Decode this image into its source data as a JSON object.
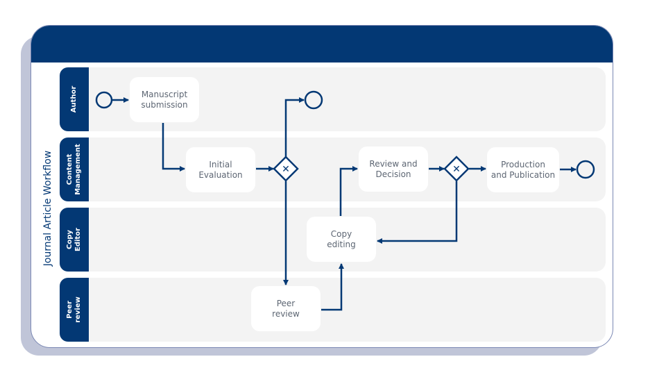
{
  "pool": {
    "title": "Journal Article Workflow"
  },
  "lanes": [
    {
      "label": "Author"
    },
    {
      "label": "Content\nManagement"
    },
    {
      "label": "Copy\nEditor"
    },
    {
      "label": "Peer\nreview"
    }
  ],
  "tasks": {
    "manuscript_submission": "Manuscript\nsubmission",
    "initial_evaluation": "Initial\nEvaluation",
    "review_decision": "Review and\nDecision",
    "production_publication": "Production\nand Publication",
    "copy_editing": "Copy\nediting",
    "peer_review": "Peer\nreview"
  },
  "gateways": [
    {
      "type": "exclusive",
      "symbol": "✕"
    },
    {
      "type": "exclusive",
      "symbol": "✕"
    }
  ],
  "colors": {
    "primary": "#033874",
    "lane_bg": "#f3f3f3",
    "task_text": "#5d6673",
    "shadow": "#c0c5d8"
  }
}
